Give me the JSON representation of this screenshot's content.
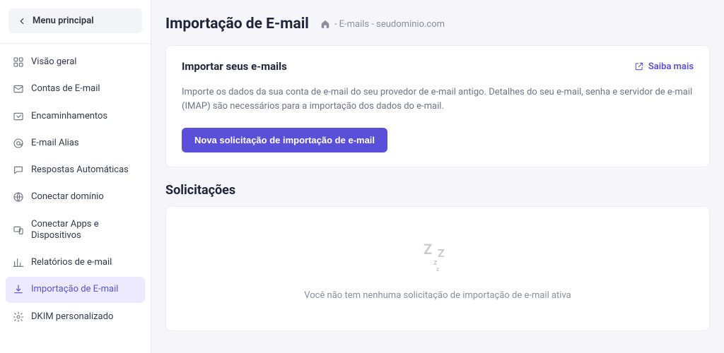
{
  "sidebar": {
    "main_menu_label": "Menu principal",
    "items": [
      {
        "label": "Visão geral"
      },
      {
        "label": "Contas de E-mail"
      },
      {
        "label": "Encaminhamentos"
      },
      {
        "label": "E-mail Alias"
      },
      {
        "label": "Respostas Automáticas"
      },
      {
        "label": "Conectar domínio"
      },
      {
        "label": "Conectar Apps e Dispositivos"
      },
      {
        "label": "Relatórios de e-mail"
      },
      {
        "label": "Importação de E-mail"
      },
      {
        "label": "DKIM personalizado"
      }
    ]
  },
  "header": {
    "title": "Importação de E-mail",
    "breadcrumb": "- E-mails - seudominio.com"
  },
  "import_card": {
    "title": "Importar seus e-mails",
    "learn_more": "Saiba mais",
    "description": "Importe os dados da sua conta de e-mail do seu provedor de e-mail antigo. Detalhes do seu e-mail, senha e servidor de e-mail (IMAP) são necessários para a importação dos dados do e-mail.",
    "button": "Nova solicitação de importação de e-mail"
  },
  "requests": {
    "title": "Solicitações",
    "empty_text": "Você não tem nenhuma solicitação de importação de e-mail ativa"
  }
}
